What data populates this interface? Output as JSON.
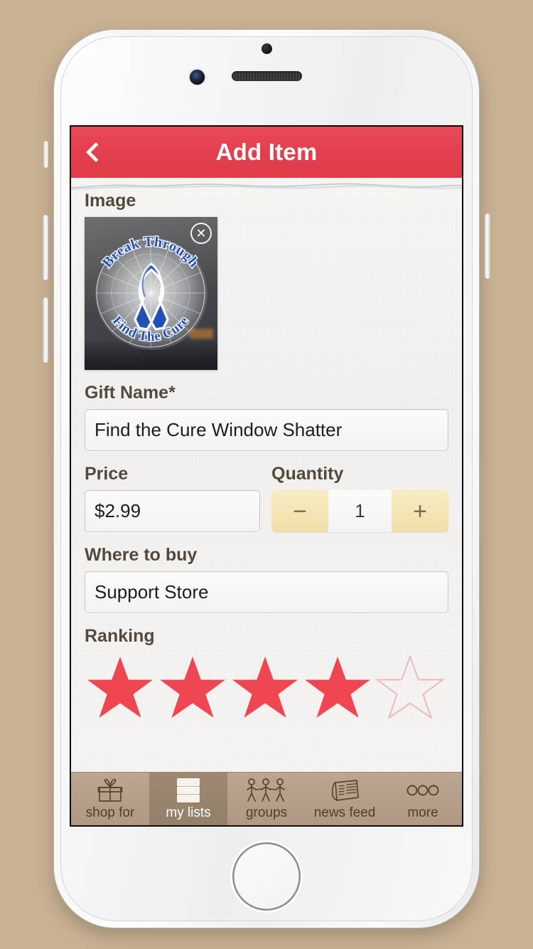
{
  "app": {
    "header": {
      "title": "Add Item",
      "back_icon": "chevron-left-icon",
      "accent_color": "#e3404f"
    }
  },
  "form": {
    "image": {
      "label": "Image",
      "alt_text": "Break Through Find The Cure",
      "caption_top": "Break Through",
      "caption_bottom": "Find The Cure",
      "remove_icon": "close-circle-icon",
      "remove_glyph": "✕"
    },
    "gift_name": {
      "label": "Gift Name*",
      "value": "Find the Cure Window Shatter",
      "placeholder": "Gift Name"
    },
    "price": {
      "label": "Price",
      "value": "$2.99",
      "placeholder": "Price"
    },
    "quantity": {
      "label": "Quantity",
      "value": "1",
      "decrement_glyph": "−",
      "increment_glyph": "+"
    },
    "where_to_buy": {
      "label": "Where to buy",
      "value": "Support Store",
      "placeholder": "Where to buy"
    },
    "ranking": {
      "label": "Ranking",
      "value": 4,
      "max": 5,
      "filled_color": "#ef4652",
      "empty_color": "#f0b8bd"
    }
  },
  "tabbar": {
    "active_index": 1,
    "items": [
      {
        "label": "shop for",
        "icon": "gift-box-icon"
      },
      {
        "label": "my lists",
        "icon": "list-lines-icon"
      },
      {
        "label": "groups",
        "icon": "people-group-icon"
      },
      {
        "label": "news feed",
        "icon": "newspaper-icon"
      },
      {
        "label": "more",
        "icon": "three-circles-icon"
      }
    ]
  }
}
